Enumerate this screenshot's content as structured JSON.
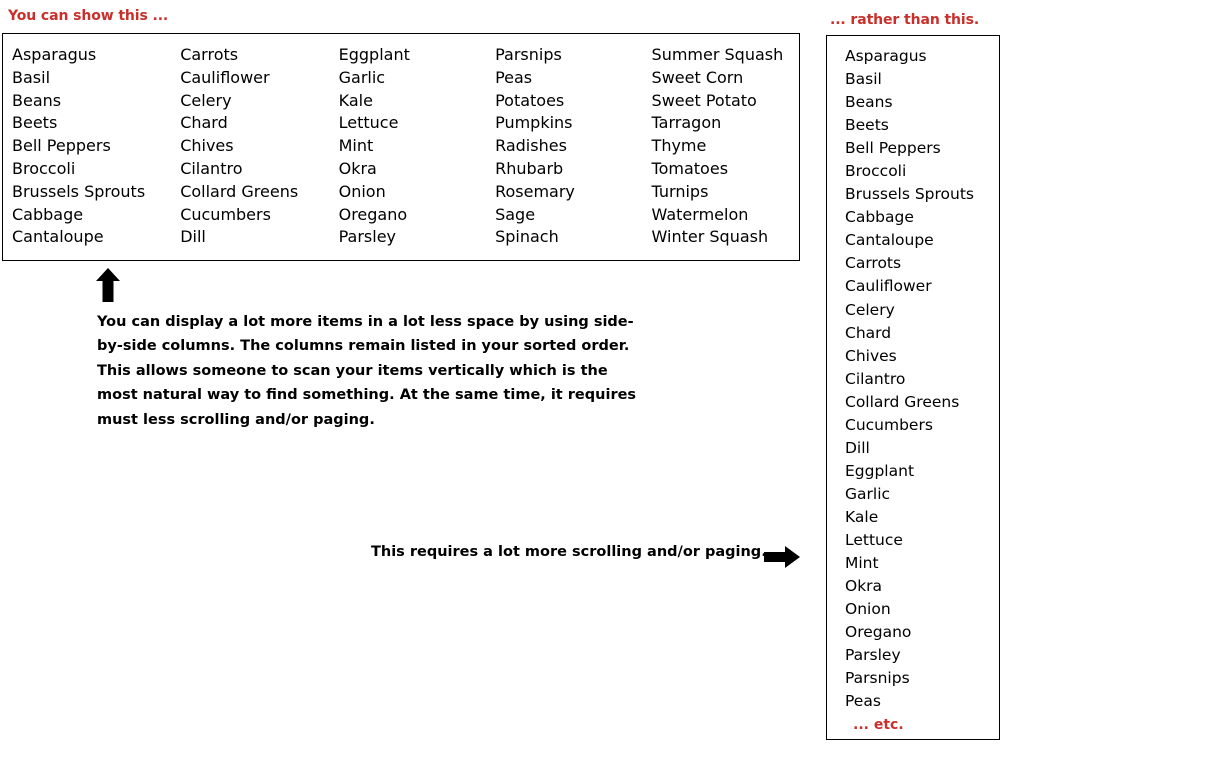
{
  "headings": {
    "left": "You can show this ...",
    "right": "... rather than this."
  },
  "colors": {
    "accent_red": "#c9302c",
    "text": "#000000",
    "border": "#000000",
    "background": "#ffffff"
  },
  "columns_box": {
    "columns": [
      {
        "items": [
          "Asparagus",
          "Basil",
          "Beans",
          "Beets",
          "Bell Peppers",
          "Broccoli",
          "Brussels Sprouts",
          "Cabbage",
          "Cantaloupe"
        ]
      },
      {
        "items": [
          "Carrots",
          "Cauliflower",
          "Celery",
          "Chard",
          "Chives",
          "Cilantro",
          "Collard Greens",
          "Cucumbers",
          "Dill"
        ]
      },
      {
        "items": [
          "Eggplant",
          "Garlic",
          "Kale",
          "Lettuce",
          "Mint",
          "Okra",
          "Onion",
          "Oregano",
          "Parsley"
        ]
      },
      {
        "items": [
          "Parsnips",
          "Peas",
          "Potatoes",
          "Pumpkins",
          "Radishes",
          "Rhubarb",
          "Rosemary",
          "Sage",
          "Spinach"
        ]
      },
      {
        "items": [
          "Summer Squash",
          "Sweet Corn",
          "Sweet Potato",
          "Tarragon",
          "Thyme",
          "Tomatoes",
          "Turnips",
          "Watermelon",
          "Winter Squash"
        ]
      }
    ]
  },
  "single_box": {
    "items": [
      "Asparagus",
      "Basil",
      "Beans",
      "Beets",
      "Bell Peppers",
      "Broccoli",
      "Brussels Sprouts",
      "Cabbage",
      "Cantaloupe",
      "Carrots",
      "Cauliflower",
      "Celery",
      "Chard",
      "Chives",
      "Cilantro",
      "Collard Greens",
      "Cucumbers",
      "Dill",
      "Eggplant",
      "Garlic",
      "Kale",
      "Lettuce",
      "Mint",
      "Okra",
      "Onion",
      "Oregano",
      "Parsley",
      "Parsnips",
      "Peas"
    ],
    "etc_label": "... etc."
  },
  "annotations": {
    "arrow_up": "up-arrow-icon",
    "arrow_right": "right-arrow-icon",
    "note_paragraph": "You can display a lot more items in a lot less space by using side-by-side columns. The columns remain listed in your sorted order. This allows someone to scan your items vertically which is the most natural way to find something. At the same time, it requires must less scrolling and/or paging.",
    "bottom_note": "This requires a lot more scrolling and/or paging."
  }
}
